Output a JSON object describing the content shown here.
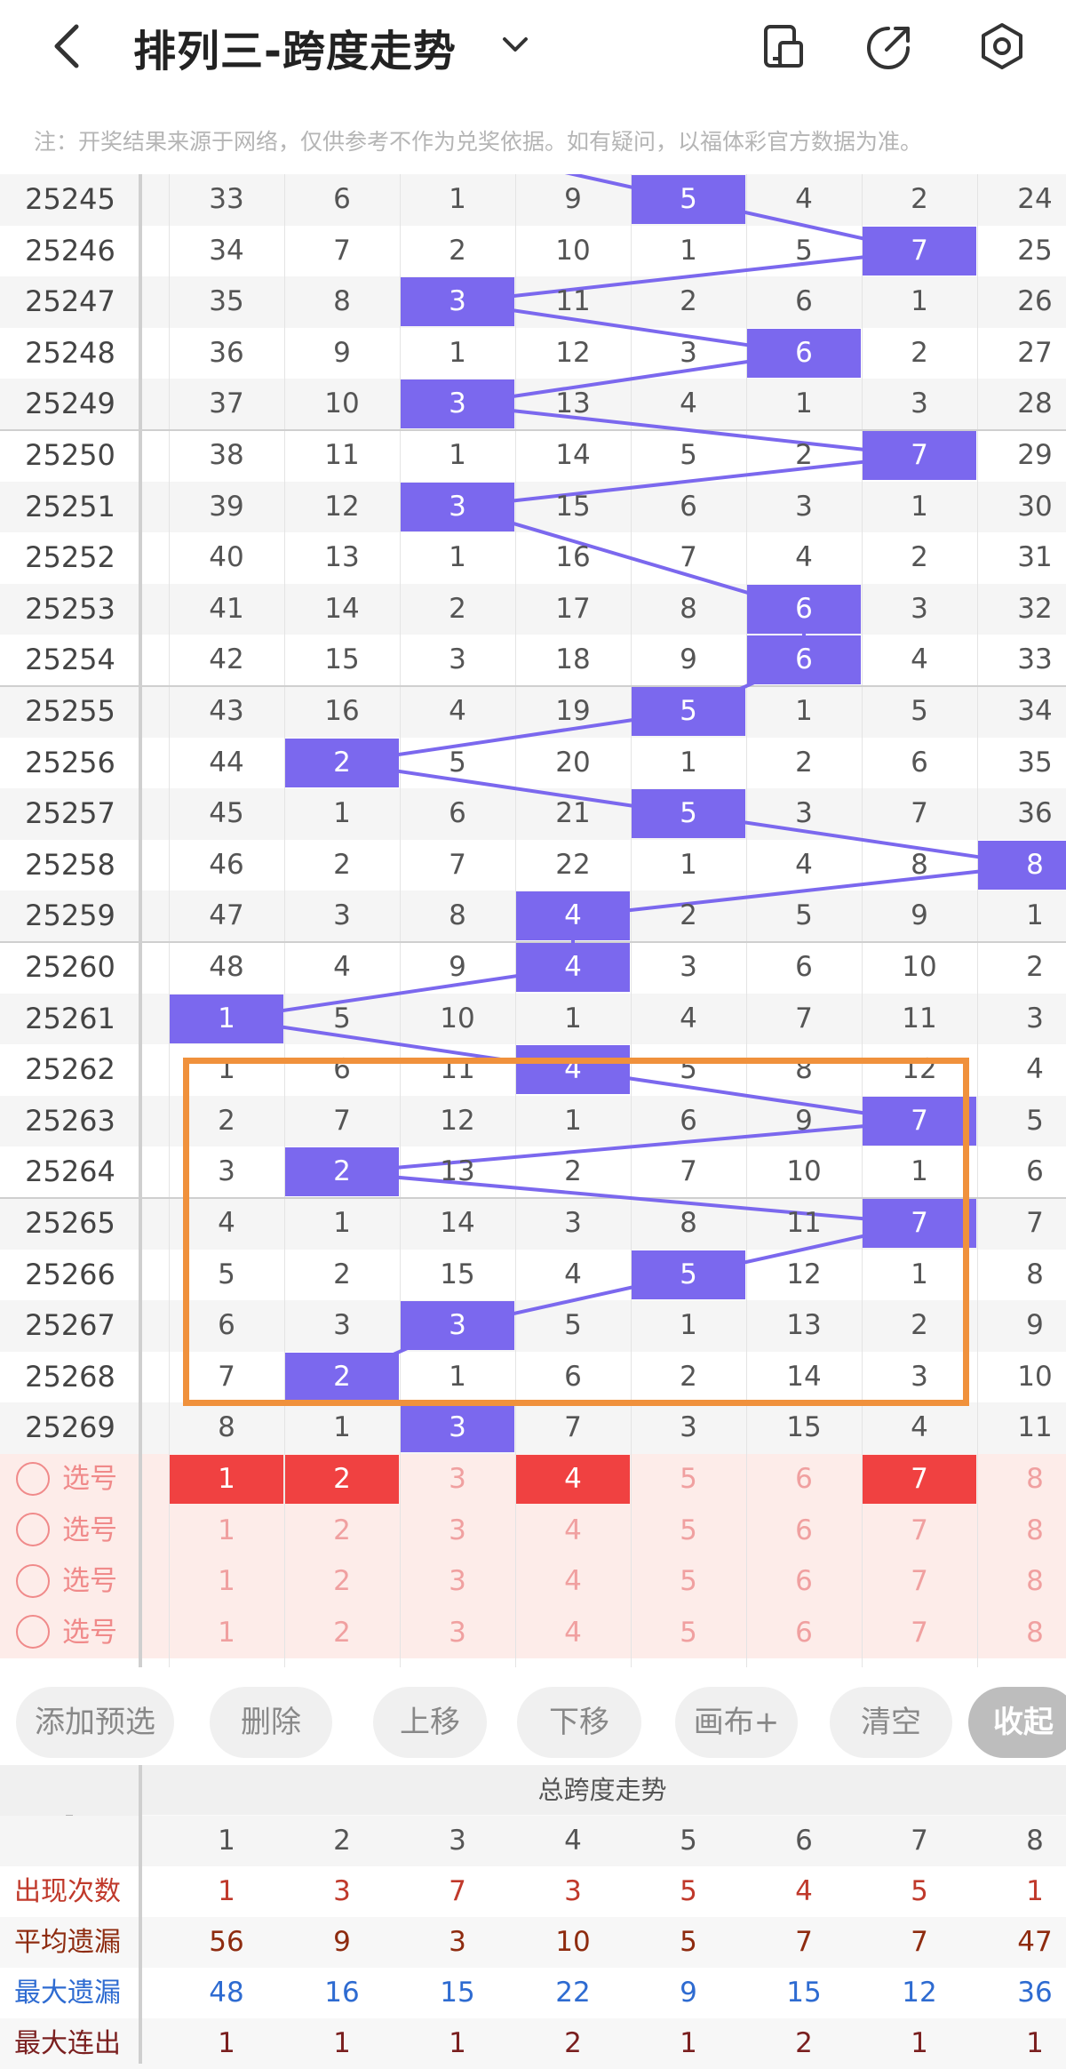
{
  "header": {
    "title": "排列三-跨度走势",
    "icons": [
      "back-icon",
      "chevron-down-icon",
      "phone-icon",
      "share-icon",
      "settings-icon"
    ]
  },
  "notice": "注：开奖结果来源于网络，仅供参考不作为兑奖依据。如有疑问，以福体彩官方数据为准。",
  "grid": {
    "accent_color": "#7b68ee",
    "rows": [
      {
        "issue": "25245",
        "cells": [
          "33",
          "6",
          "1",
          "9",
          "5",
          "4",
          "2",
          "24"
        ],
        "hit": 4
      },
      {
        "issue": "25246",
        "cells": [
          "34",
          "7",
          "2",
          "10",
          "1",
          "5",
          "7",
          "25"
        ],
        "hit": 6
      },
      {
        "issue": "25247",
        "cells": [
          "35",
          "8",
          "3",
          "11",
          "2",
          "6",
          "1",
          "26"
        ],
        "hit": 2
      },
      {
        "issue": "25248",
        "cells": [
          "36",
          "9",
          "1",
          "12",
          "3",
          "6",
          "2",
          "27"
        ],
        "hit": 5
      },
      {
        "issue": "25249",
        "cells": [
          "37",
          "10",
          "3",
          "13",
          "4",
          "1",
          "3",
          "28"
        ],
        "hit": 2
      },
      {
        "issue": "25250",
        "cells": [
          "38",
          "11",
          "1",
          "14",
          "5",
          "2",
          "7",
          "29"
        ],
        "hit": 6
      },
      {
        "issue": "25251",
        "cells": [
          "39",
          "12",
          "3",
          "15",
          "6",
          "3",
          "1",
          "30"
        ],
        "hit": 2
      },
      {
        "issue": "25252",
        "cells": [
          "40",
          "13",
          "1",
          "16",
          "7",
          "4",
          "2",
          "31"
        ],
        "hit": 8
      },
      {
        "issue": "25253",
        "cells": [
          "41",
          "14",
          "2",
          "17",
          "8",
          "6",
          "3",
          "32"
        ],
        "hit": 5
      },
      {
        "issue": "25254",
        "cells": [
          "42",
          "15",
          "3",
          "18",
          "9",
          "6",
          "4",
          "33"
        ],
        "hit": 5
      },
      {
        "issue": "25255",
        "cells": [
          "43",
          "16",
          "4",
          "19",
          "5",
          "1",
          "5",
          "34"
        ],
        "hit": 4
      },
      {
        "issue": "25256",
        "cells": [
          "44",
          "2",
          "5",
          "20",
          "1",
          "2",
          "6",
          "35"
        ],
        "hit": 1
      },
      {
        "issue": "25257",
        "cells": [
          "45",
          "1",
          "6",
          "21",
          "5",
          "3",
          "7",
          "36"
        ],
        "hit": 4
      },
      {
        "issue": "25258",
        "cells": [
          "46",
          "2",
          "7",
          "22",
          "1",
          "4",
          "8",
          "8"
        ],
        "hit": 7
      },
      {
        "issue": "25259",
        "cells": [
          "47",
          "3",
          "8",
          "4",
          "2",
          "5",
          "9",
          "1"
        ],
        "hit": 3
      },
      {
        "issue": "25260",
        "cells": [
          "48",
          "4",
          "9",
          "4",
          "3",
          "6",
          "10",
          "2"
        ],
        "hit": 3
      },
      {
        "issue": "25261",
        "cells": [
          "1",
          "5",
          "10",
          "1",
          "4",
          "7",
          "11",
          "3"
        ],
        "hit": 0
      },
      {
        "issue": "25262",
        "cells": [
          "1",
          "6",
          "11",
          "4",
          "5",
          "8",
          "12",
          "4"
        ],
        "hit": 3
      },
      {
        "issue": "25263",
        "cells": [
          "2",
          "7",
          "12",
          "1",
          "6",
          "9",
          "7",
          "5"
        ],
        "hit": 6
      },
      {
        "issue": "25264",
        "cells": [
          "3",
          "2",
          "13",
          "2",
          "7",
          "10",
          "1",
          "6"
        ],
        "hit": 1
      },
      {
        "issue": "25265",
        "cells": [
          "4",
          "1",
          "14",
          "3",
          "8",
          "11",
          "7",
          "7"
        ],
        "hit": 6
      },
      {
        "issue": "25266",
        "cells": [
          "5",
          "2",
          "15",
          "4",
          "5",
          "12",
          "1",
          "8"
        ],
        "hit": 4
      },
      {
        "issue": "25267",
        "cells": [
          "6",
          "3",
          "3",
          "5",
          "1",
          "13",
          "2",
          "9"
        ],
        "hit": 2
      },
      {
        "issue": "25268",
        "cells": [
          "7",
          "2",
          "1",
          "6",
          "2",
          "14",
          "3",
          "10"
        ],
        "hit": 1
      },
      {
        "issue": "25269",
        "cells": [
          "8",
          "1",
          "3",
          "7",
          "3",
          "15",
          "4",
          "11"
        ],
        "hit": 2
      }
    ],
    "select_label": "选号",
    "select_rows": [
      {
        "cells": [
          "1",
          "2",
          "3",
          "4",
          "5",
          "6",
          "7",
          "8"
        ],
        "selected": [
          0,
          1,
          3,
          6
        ]
      },
      {
        "cells": [
          "1",
          "2",
          "3",
          "4",
          "5",
          "6",
          "7",
          "8"
        ],
        "selected": []
      },
      {
        "cells": [
          "1",
          "2",
          "3",
          "4",
          "5",
          "6",
          "7",
          "8"
        ],
        "selected": []
      },
      {
        "cells": [
          "1",
          "2",
          "3",
          "4",
          "5",
          "6",
          "7",
          "8"
        ],
        "selected": []
      }
    ]
  },
  "toolbar": {
    "buttons": [
      "添加预选",
      "删除",
      "上移",
      "下移",
      "画布+",
      "清空",
      "收起"
    ]
  },
  "stats": {
    "dash": "-",
    "title": "总跨度走势",
    "columns": [
      "1",
      "2",
      "3",
      "4",
      "5",
      "6",
      "7",
      "8"
    ],
    "rows": [
      {
        "label": "出现次数",
        "color": "#c0392b",
        "values": [
          "1",
          "3",
          "7",
          "3",
          "5",
          "4",
          "5",
          "1"
        ]
      },
      {
        "label": "平均遗漏",
        "color": "#8e2b0f",
        "values": [
          "56",
          "9",
          "3",
          "10",
          "5",
          "7",
          "7",
          "47"
        ]
      },
      {
        "label": "最大遗漏",
        "color": "#2e6bd1",
        "values": [
          "48",
          "16",
          "15",
          "22",
          "9",
          "15",
          "12",
          "36"
        ]
      },
      {
        "label": "最大连出",
        "color": "#7a1f1f",
        "values": [
          "1",
          "1",
          "1",
          "2",
          "1",
          "2",
          "1",
          "1"
        ]
      }
    ]
  }
}
